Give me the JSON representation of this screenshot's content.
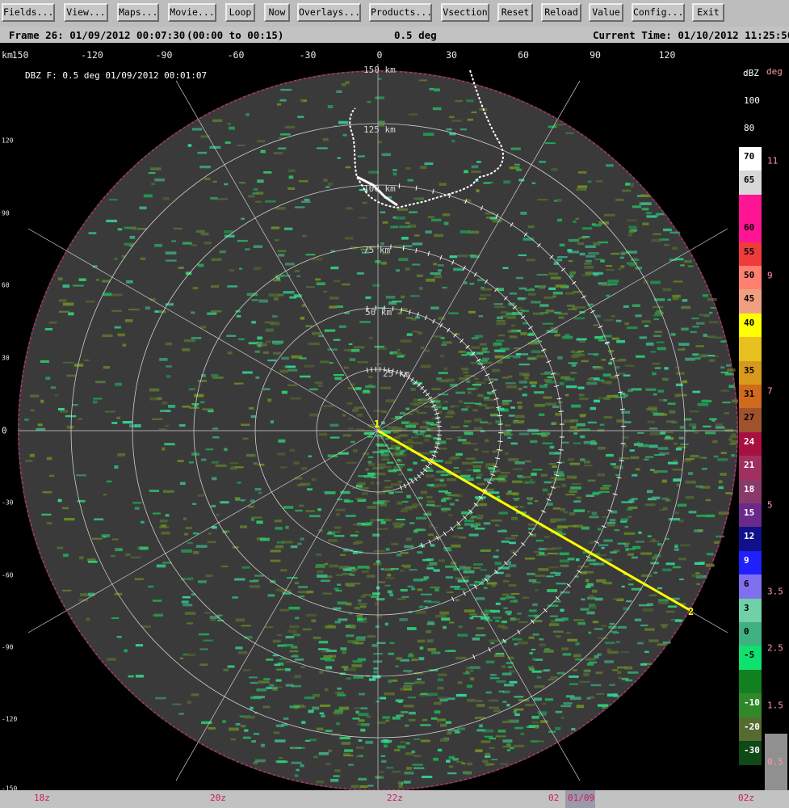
{
  "toolbar": {
    "buttons": [
      "Fields...",
      "View...",
      "Maps...",
      "Movie...",
      "Loop",
      "Now",
      "Overlays...",
      "Products...",
      "Vsection",
      "Reset",
      "Reload",
      "Value",
      "Config...",
      "Exit"
    ]
  },
  "status": {
    "frame": "Frame 26: 01/09/2012 00:07:30",
    "range": "(00:00 to 00:15)",
    "elevation": "0.5 deg",
    "current_time": "Current Time: 01/10/2012 11:25:50"
  },
  "ppi": {
    "title": "DBZ F: 0.5 deg 01/09/2012 00:01:07",
    "top_axis_unit": "km",
    "top_axis_ticks": [
      "150",
      "-120",
      "-90",
      "-60",
      "-30",
      "0",
      "30",
      "60",
      "90",
      "120"
    ],
    "left_axis_ticks": [
      "120",
      "90",
      "60",
      "30",
      "0",
      "-30",
      "-60",
      "-90",
      "-120",
      "-150"
    ],
    "range_ring_labels": [
      "25 km",
      "50 km",
      "75 km",
      "100 km",
      "125 km",
      "150 km"
    ],
    "vsection_points": [
      "1",
      "2"
    ]
  },
  "colors": {
    "background": "#000000",
    "scan_fill": "#3a3a3a",
    "echo_green": "#2ecc71",
    "echo_olive": "#556b2f",
    "vsection_line": "#ffff00"
  },
  "color_scale": {
    "unit": "dBZ",
    "top_labels": [
      "100",
      "80"
    ],
    "entries": [
      {
        "label": "70",
        "color": "#ffffff"
      },
      {
        "label": "65",
        "color": "#d8d8d8"
      },
      {
        "label": "",
        "color": "#ff1493"
      },
      {
        "label": "60",
        "color": "#ff1493"
      },
      {
        "label": "55",
        "color": "#ee3b3b"
      },
      {
        "label": "50",
        "color": "#ff8070"
      },
      {
        "label": "45",
        "color": "#f0a080"
      },
      {
        "label": "40",
        "color": "#ffff00"
      },
      {
        "label": "",
        "color": "#e8c020"
      },
      {
        "label": "35",
        "color": "#d89a1c"
      },
      {
        "label": "31",
        "color": "#d06a1c"
      },
      {
        "label": "27",
        "color": "#a0522d"
      },
      {
        "label": "24",
        "color": "#a81040"
      },
      {
        "label": "21",
        "color": "#a03060"
      },
      {
        "label": "18",
        "color": "#8a3a6a"
      },
      {
        "label": "15",
        "color": "#6a2a8a"
      },
      {
        "label": "12",
        "color": "#10108a"
      },
      {
        "label": "9",
        "color": "#2020ff"
      },
      {
        "label": "6",
        "color": "#8070f0"
      },
      {
        "label": "3",
        "color": "#70d0a8"
      },
      {
        "label": "0",
        "color": "#40b080"
      },
      {
        "label": "-5",
        "color": "#10e070"
      },
      {
        "label": "",
        "color": "#108020"
      },
      {
        "label": "-10",
        "color": "#308828"
      },
      {
        "label": "-20",
        "color": "#556b2f"
      },
      {
        "label": "-30",
        "color": "#104818"
      }
    ]
  },
  "deg_scale": {
    "unit": "deg",
    "ticks": [
      "11",
      "9",
      "7",
      "5",
      "3.5",
      "2.5",
      "1.5",
      "0.5"
    ]
  },
  "time_axis": {
    "labels": [
      "18z",
      "20z",
      "22z",
      "02",
      "01/09",
      "02z"
    ]
  }
}
